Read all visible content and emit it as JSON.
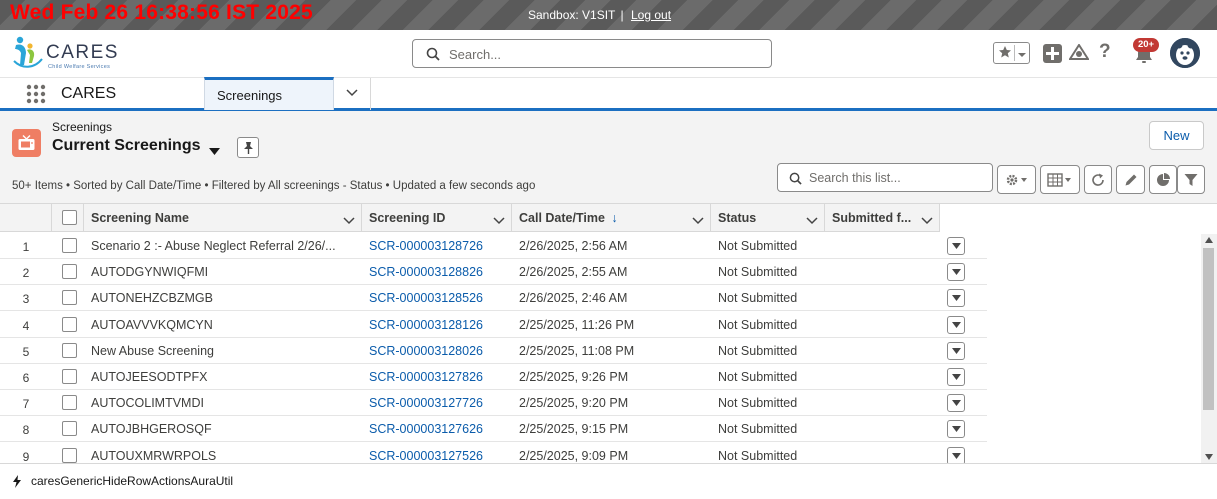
{
  "banner": {
    "clock": "Wed Feb 26 16:38:56 IST 2025",
    "sandbox_label": "Sandbox: V1SIT",
    "separator": "|",
    "logout_label": "Log out"
  },
  "header": {
    "logo_text": "CARES",
    "logo_subtext": "Child Welfare Services",
    "search_placeholder": "Search...",
    "notification_count": "20+",
    "help_label": "?"
  },
  "nav": {
    "app_name": "CARES",
    "tabs": [
      {
        "label": "Screenings"
      }
    ]
  },
  "list_view": {
    "object_label": "Screenings",
    "title": "Current Screenings",
    "new_button": "New",
    "info": "50+ Items • Sorted by Call Date/Time • Filtered by All screenings - Status • Updated a few seconds ago",
    "search_placeholder": "Search this list...",
    "columns": [
      {
        "label": "Screening Name"
      },
      {
        "label": "Screening ID"
      },
      {
        "label": "Call Date/Time"
      },
      {
        "label": "Status"
      },
      {
        "label": "Submitted f..."
      }
    ],
    "sort_indicator": "↓",
    "rows": [
      {
        "num": "1",
        "name": "Scenario 2 :- Abuse Neglect Referral 2/26/...",
        "id": "SCR-000003128726",
        "date": "2/26/2025, 2:56 AM",
        "status": "Not Submitted"
      },
      {
        "num": "2",
        "name": "AUTODGYNWIQFMI",
        "id": "SCR-000003128826",
        "date": "2/26/2025, 2:55 AM",
        "status": "Not Submitted"
      },
      {
        "num": "3",
        "name": "AUTONEHZCBZMGB",
        "id": "SCR-000003128526",
        "date": "2/26/2025, 2:46 AM",
        "status": "Not Submitted"
      },
      {
        "num": "4",
        "name": "AUTOAVVVKQMCYN",
        "id": "SCR-000003128126",
        "date": "2/25/2025, 11:26 PM",
        "status": "Not Submitted"
      },
      {
        "num": "5",
        "name": "New Abuse Screening",
        "id": "SCR-000003128026",
        "date": "2/25/2025, 11:08 PM",
        "status": "Not Submitted"
      },
      {
        "num": "6",
        "name": "AUTOJEESODTPFX",
        "id": "SCR-000003127826",
        "date": "2/25/2025, 9:26 PM",
        "status": "Not Submitted"
      },
      {
        "num": "7",
        "name": "AUTOCOLIMTVMDI",
        "id": "SCR-000003127726",
        "date": "2/25/2025, 9:20 PM",
        "status": "Not Submitted"
      },
      {
        "num": "8",
        "name": "AUTOJBHGEROSQF",
        "id": "SCR-000003127626",
        "date": "2/25/2025, 9:15 PM",
        "status": "Not Submitted"
      },
      {
        "num": "9",
        "name": "AUTOUXMRWRPOLS",
        "id": "SCR-000003127526",
        "date": "2/25/2025, 9:09 PM",
        "status": "Not Submitted"
      }
    ]
  },
  "utility_bar": {
    "item_label": "caresGenericHideRowActionsAuraUtil"
  },
  "icons": {
    "search": "search-icon",
    "favorite": "star-icon",
    "add": "plus-icon",
    "trailhead": "trailhead-icon",
    "notifications": "bell-icon",
    "app_launcher": "waffle-icon",
    "object": "screening-object-icon",
    "pin": "pin-icon",
    "settings": "gear-icon",
    "display_as": "table-icon",
    "refresh": "refresh-icon",
    "edit": "pencil-icon",
    "chart": "chart-icon",
    "filter": "filter-icon",
    "utility": "lightning-icon"
  },
  "colors": {
    "banner_clock": "#ff0000",
    "link": "#0b5cab",
    "nav_accent": "#1b6fc1",
    "object_icon": "#ef7e64",
    "badge": "#c23934"
  }
}
